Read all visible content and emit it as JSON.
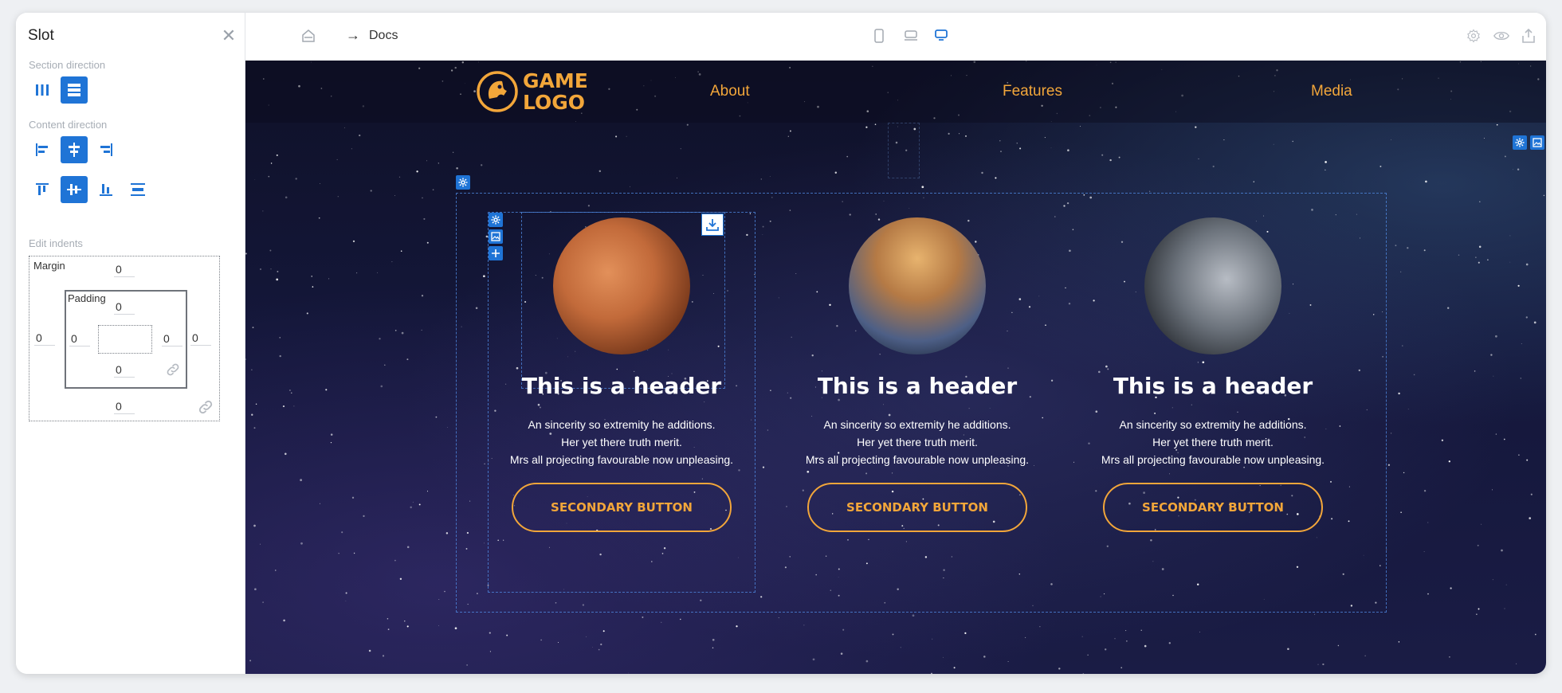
{
  "panel": {
    "title": "Slot",
    "section_direction_label": "Section direction",
    "content_direction_label": "Content direction",
    "edit_indents_label": "Edit indents",
    "margin_label": "Margin",
    "padding_label": "Padding",
    "margin": {
      "top": "0",
      "right": "0",
      "bottom": "0",
      "left": "0"
    },
    "padding": {
      "top": "0",
      "right": "0",
      "bottom": "0",
      "left": "0"
    }
  },
  "toolbar": {
    "breadcrumb_arrow": "→",
    "breadcrumb_page": "Docs",
    "icons": [
      "home-icon",
      "mobile-view-icon",
      "tablet-view-icon",
      "desktop-view-icon",
      "settings-icon",
      "preview-eye-icon",
      "export-icon"
    ]
  },
  "site": {
    "logo_line1": "GAME",
    "logo_line2": "LOGO",
    "nav": [
      "About",
      "Features",
      "Media"
    ],
    "cards": [
      {
        "title": "This is a header",
        "desc_lines": [
          "An sincerity so extremity he additions.",
          "Her yet there truth merit.",
          "Mrs all projecting favourable now unpleasing."
        ],
        "button": "SECONDARY BUTTON",
        "image": "planet-with-spaceship"
      },
      {
        "title": "This is a header",
        "desc_lines": [
          "An sincerity so extremity he additions.",
          "Her yet there truth merit.",
          "Mrs all projecting favourable now unpleasing."
        ],
        "button": "SECONDARY BUTTON",
        "image": "planet-with-space-station"
      },
      {
        "title": "This is a header",
        "desc_lines": [
          "An sincerity so extremity he additions.",
          "Her yet there truth merit.",
          "Mrs all projecting favourable now unpleasing."
        ],
        "button": "SECONDARY BUTTON",
        "image": "astronaut-helmet-portrait"
      }
    ]
  },
  "colors": {
    "accent": "#1f74d6",
    "brand_orange": "#f2a63a",
    "canvas_bg": "#14173a"
  }
}
